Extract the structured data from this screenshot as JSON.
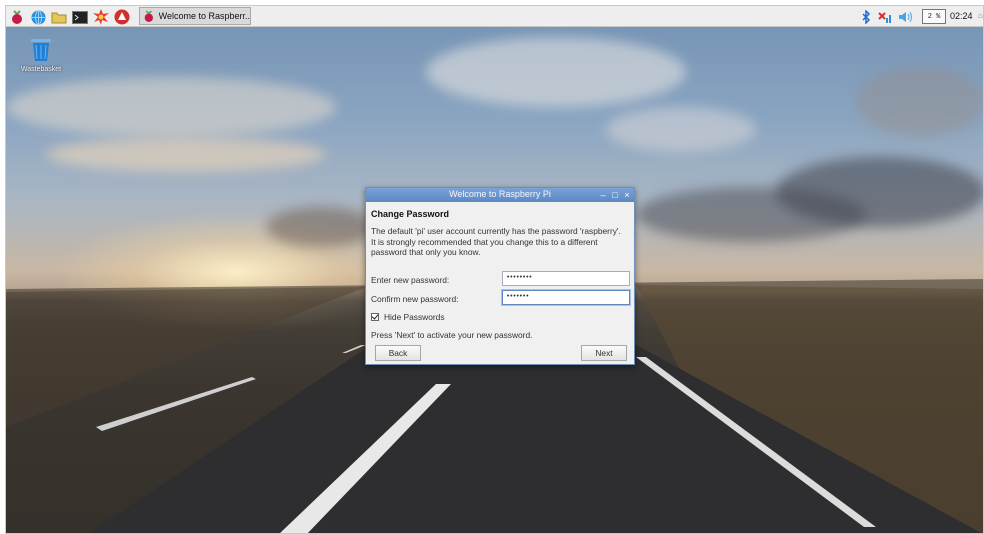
{
  "taskbar": {
    "launcher_icons": [
      "raspberry-menu-icon",
      "globe-browser-icon",
      "folder-icon",
      "terminal-icon",
      "burst-icon",
      "mathematica-icon"
    ],
    "window_button": {
      "icon": "raspberry-icon",
      "title": "Welcome to Raspberr..."
    },
    "tray": {
      "icons": [
        "bluetooth-icon",
        "network-disconnected-icon",
        "volume-icon"
      ],
      "cpu_monitor": "2 %",
      "clock": "02:24",
      "more": "⌂"
    }
  },
  "desktop": {
    "trash_label": "Wastebasket"
  },
  "dialog": {
    "title": "Welcome to Raspberry Pi",
    "controls": [
      "–",
      "□",
      "×"
    ],
    "heading": "Change Password",
    "description_lines": [
      "The default 'pi' user account currently has the password 'raspberry'.",
      "It is strongly recommended that you change this to a different",
      "password that only you know."
    ],
    "new_password_label": "Enter new password:",
    "new_password_value": "••••••••",
    "confirm_password_label": "Confirm new password:",
    "confirm_password_value": "•••••••",
    "hide_passwords_label": "Hide Passwords",
    "hide_passwords_checked": true,
    "hint": "Press 'Next' to activate your new password.",
    "back_label": "Back",
    "next_label": "Next"
  },
  "colors": {
    "titlebar": "#5c88c4",
    "taskbar": "#eeeeee",
    "trash_blue": "#1e7fd6",
    "raspberry_red": "#c51a4a"
  }
}
